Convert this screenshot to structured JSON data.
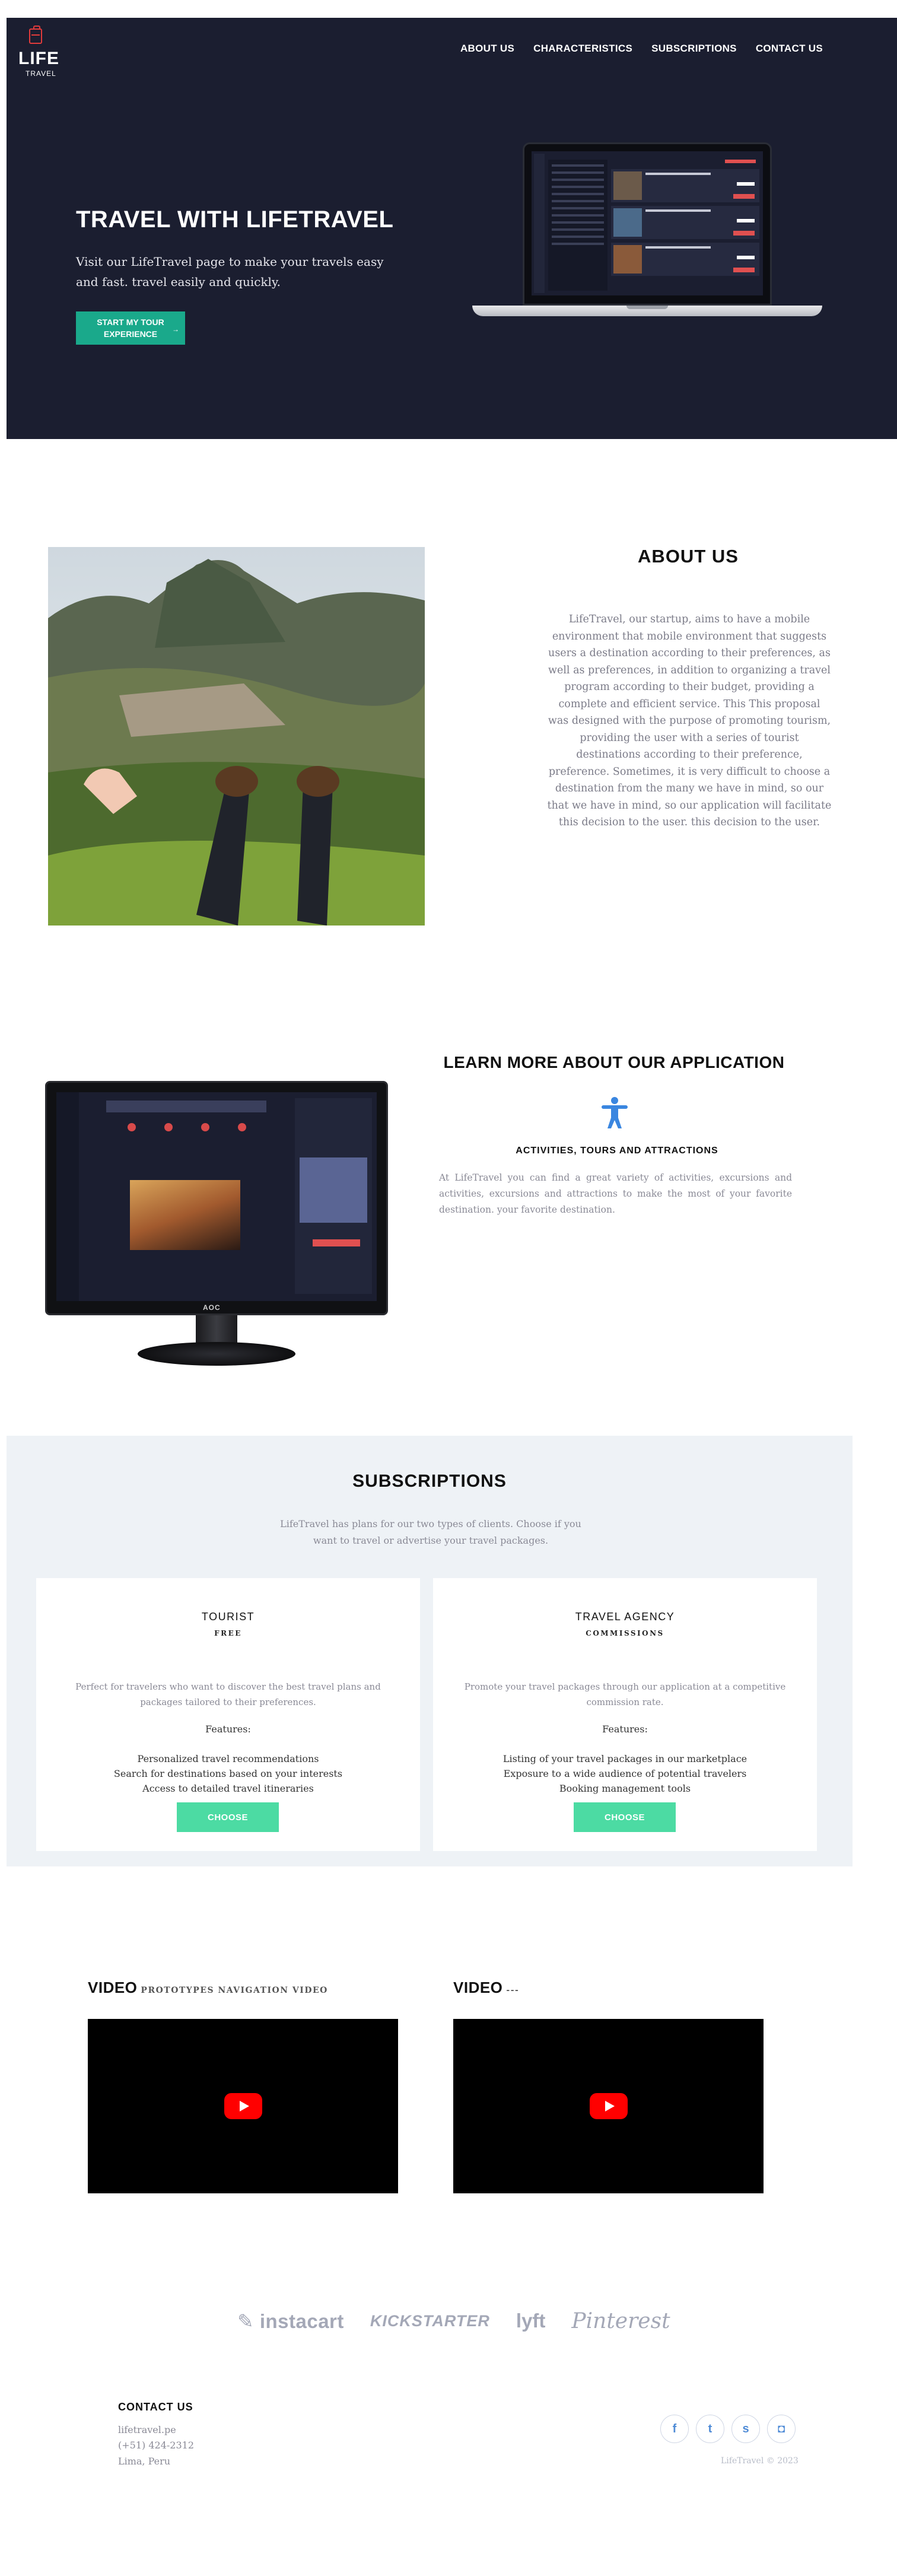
{
  "brand": {
    "name": "LIFE",
    "tagline": "TRAVEL"
  },
  "nav": [
    "ABOUT US",
    "CHARACTERISTICS",
    "SUBSCRIPTIONS",
    "CONTACT US"
  ],
  "hero": {
    "title": "TRAVEL WITH LIFETRAVEL",
    "subtitle": "Visit our LifeTravel page to make your travels easy and fast. travel easily and quickly.",
    "cta": "START MY TOUR EXPERIENCE",
    "cta_arrow": "→"
  },
  "about": {
    "title": "ABOUT US",
    "text": "LifeTravel, our startup, aims to have a mobile environment that mobile environment that suggests users a destination according to their preferences, as well as preferences, in addition to organizing a travel program according to their budget, providing a complete and efficient service. This This proposal was designed with the purpose of promoting tourism, providing the user with a series of tourist destinations according to their preference, preference. Sometimes, it is very difficult to choose a destination from the many we have in mind, so our that we have in mind, so our application will facilitate this decision to the user. this decision to the user."
  },
  "learn": {
    "title": "LEARN MORE ABOUT OUR APPLICATION",
    "icon": "accessibility-person-icon",
    "subtitle": "ACTIVITIES, TOURS AND ATTRACTIONS",
    "text": "At LifeTravel you can find a great variety of activities, excursions and activities, excursions and attractions to make the most of your favorite destination. your favorite destination."
  },
  "subscriptions": {
    "title": "SUBSCRIPTIONS",
    "text": "LifeTravel has plans for our two types of clients. Choose if you want to travel or advertise your travel packages.",
    "plans": [
      {
        "name": "TOURIST",
        "kind": "FREE",
        "description": "Perfect for travelers who want to discover the best travel plans and packages tailored to their preferences.",
        "features_label": "Features:",
        "features": [
          "Personalized travel recommendations",
          "Search for destinations based on your interests",
          "Access to detailed travel itineraries"
        ],
        "button": "CHOOSE"
      },
      {
        "name": "TRAVEL AGENCY",
        "kind": "COMMISSIONS",
        "description": "Promote your travel packages through our application at a competitive commission rate.",
        "features_label": "Features:",
        "features": [
          "Listing of your travel packages in our marketplace",
          "Exposure to a wide audience of potential travelers",
          "Booking management tools"
        ],
        "button": "CHOOSE"
      }
    ]
  },
  "videos": [
    {
      "title": "VIDEO",
      "subtitle": "PROTOTYPES NAVIGATION VIDEO"
    },
    {
      "title": "VIDEO",
      "subtitle": "---"
    }
  ],
  "partner_logos": [
    "instacart",
    "KICKSTARTER",
    "lyft",
    "Pinterest"
  ],
  "footer": {
    "contact_title": "CONTACT US",
    "lines": [
      "lifetravel.pe",
      "(+51) 424-2312",
      "Lima, Peru"
    ],
    "social": [
      "facebook-icon",
      "twitter-icon",
      "snapchat-icon",
      "instagram-icon"
    ],
    "social_glyphs": [
      "f",
      "t",
      "s",
      "◘"
    ],
    "copyright": "LifeTravel © 2023"
  }
}
